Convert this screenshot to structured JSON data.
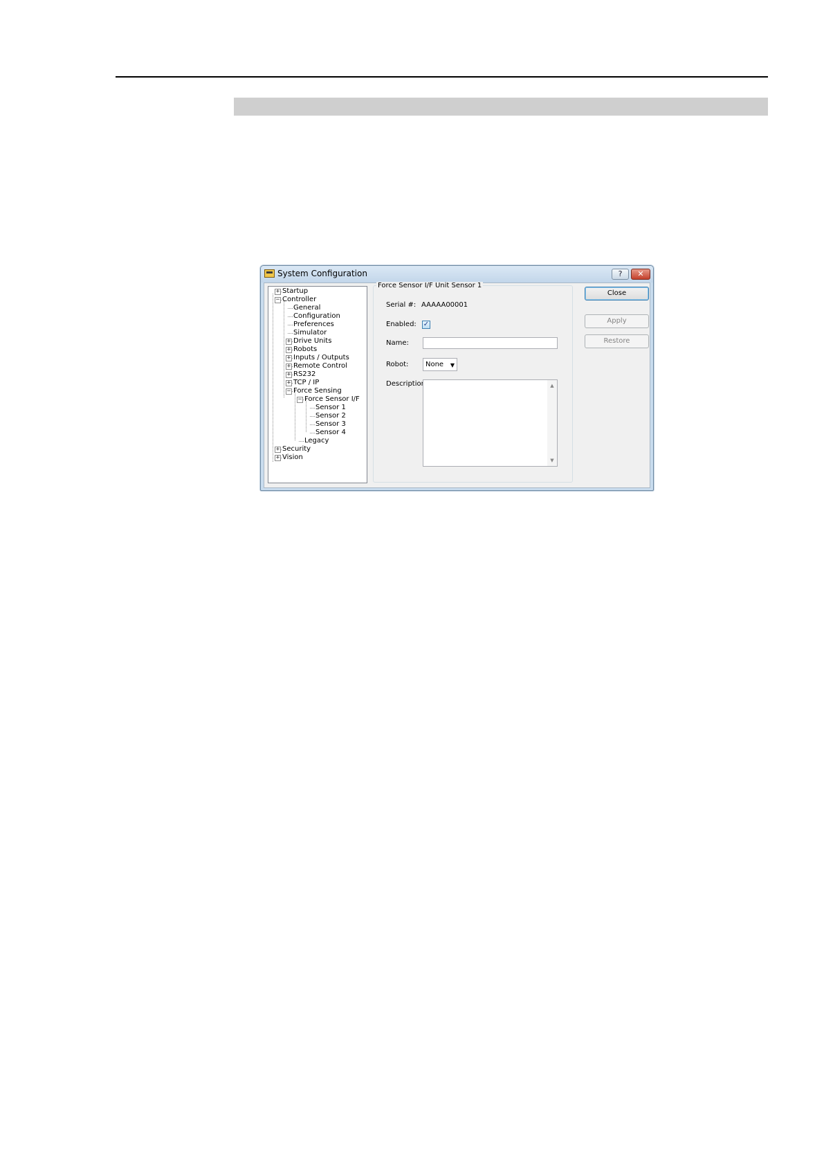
{
  "window": {
    "title": "System Configuration",
    "help_label": "?",
    "close_glyph": "✕"
  },
  "tree": {
    "items": [
      {
        "label": "Startup",
        "expander": "+"
      },
      {
        "label": "Controller",
        "expander": "−"
      },
      {
        "label": "General",
        "expander": ""
      },
      {
        "label": "Configuration",
        "expander": ""
      },
      {
        "label": "Preferences",
        "expander": ""
      },
      {
        "label": "Simulator",
        "expander": ""
      },
      {
        "label": "Drive Units",
        "expander": "+"
      },
      {
        "label": "Robots",
        "expander": "+"
      },
      {
        "label": "Inputs / Outputs",
        "expander": "+"
      },
      {
        "label": "Remote Control",
        "expander": "+"
      },
      {
        "label": "RS232",
        "expander": "+"
      },
      {
        "label": "TCP / IP",
        "expander": "+"
      },
      {
        "label": "Force Sensing",
        "expander": "−"
      },
      {
        "label": "Force Sensor I/F",
        "expander": "−"
      },
      {
        "label": "Sensor 1",
        "expander": ""
      },
      {
        "label": "Sensor 2",
        "expander": ""
      },
      {
        "label": "Sensor 3",
        "expander": ""
      },
      {
        "label": "Sensor 4",
        "expander": ""
      },
      {
        "label": "Legacy",
        "expander": ""
      },
      {
        "label": "Security",
        "expander": "+"
      },
      {
        "label": "Vision",
        "expander": "+"
      }
    ]
  },
  "panel": {
    "group_title": "Force Sensor I/F Unit Sensor 1",
    "serial_label": "Serial #:",
    "serial_value": "AAAAA00001",
    "enabled_label": "Enabled:",
    "enabled_checked": true,
    "enabled_glyph": "✓",
    "name_label": "Name:",
    "name_value": "",
    "robot_label": "Robot:",
    "robot_value": "None",
    "description_label": "Description:",
    "description_value": ""
  },
  "buttons": {
    "close": "Close",
    "apply": "Apply",
    "restore": "Restore"
  }
}
